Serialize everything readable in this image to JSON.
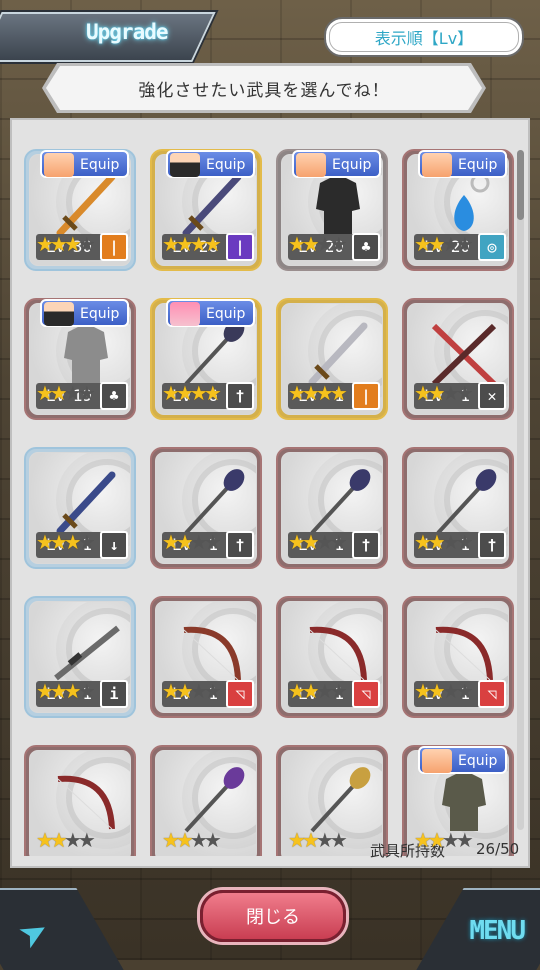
{
  "header": {
    "title": "Upgrade",
    "sort_label": "表示順【Lv】"
  },
  "banner": "強化させたい武具を選んでね！",
  "inventory": {
    "count_label": "武具所持数",
    "count_value": "26/50"
  },
  "bottom": {
    "close_label": "閉じる",
    "menu_label": "MENU"
  },
  "equip_label": "Equip",
  "lv_prefix": "Lv",
  "items": [
    {
      "name": "flame-sword",
      "rarity": "blue",
      "stars": 3,
      "level": "30",
      "type": "sword",
      "equip": "orange-hair",
      "color": "#d98a2b"
    },
    {
      "name": "dark-greatsword",
      "rarity": "gold",
      "stars": 4,
      "level": "26",
      "type": "greatsword",
      "equip": "black-hair",
      "color": "#4a4a7a"
    },
    {
      "name": "black-coat",
      "rarity": "gray",
      "stars": 2,
      "level": "20",
      "type": "armor",
      "equip": "orange-hair",
      "color": "#2b2b2b"
    },
    {
      "name": "blue-pendant",
      "rarity": "red",
      "stars": 2,
      "level": "20",
      "type": "accessory",
      "equip": "orange-hair",
      "color": "#2a8de0"
    },
    {
      "name": "plate-armor",
      "rarity": "red",
      "stars": 2,
      "level": "19",
      "type": "armor",
      "equip": "black-hair",
      "color": "#8c8c8c"
    },
    {
      "name": "spiked-mace",
      "rarity": "gold",
      "stars": 4,
      "level": "6",
      "type": "mace",
      "equip": "pink-hair",
      "color": "#3a3a5a"
    },
    {
      "name": "golden-sword",
      "rarity": "gold",
      "stars": 4,
      "level": "1",
      "type": "sword",
      "equip": "",
      "color": "#b8b8c0"
    },
    {
      "name": "crossed-blades",
      "rarity": "red",
      "stars": 2,
      "level": "1",
      "type": "dual",
      "equip": "",
      "color": "#5a2a2a"
    },
    {
      "name": "blue-spear",
      "rarity": "blue",
      "stars": 3,
      "level": "1",
      "type": "dagger",
      "equip": "",
      "color": "#3a4a8a"
    },
    {
      "name": "iron-mace-a",
      "rarity": "red",
      "stars": 2,
      "level": "1",
      "type": "mace",
      "equip": "",
      "color": "#3a3a6a"
    },
    {
      "name": "iron-mace-b",
      "rarity": "red",
      "stars": 2,
      "level": "1",
      "type": "mace",
      "equip": "",
      "color": "#3a3a6a"
    },
    {
      "name": "iron-mace-c",
      "rarity": "red",
      "stars": 2,
      "level": "1",
      "type": "mace",
      "equip": "",
      "color": "#3a3a6a"
    },
    {
      "name": "sniper-rifle",
      "rarity": "blue",
      "stars": 3,
      "level": "1",
      "type": "gun",
      "equip": "",
      "color": "#6a6a6a"
    },
    {
      "name": "ornate-bow",
      "rarity": "red",
      "stars": 2,
      "level": "1",
      "type": "bow",
      "equip": "",
      "color": "#8a3a2a"
    },
    {
      "name": "red-bow-a",
      "rarity": "red",
      "stars": 2,
      "level": "1",
      "type": "bow",
      "equip": "",
      "color": "#8a2a2a"
    },
    {
      "name": "red-bow-b",
      "rarity": "red",
      "stars": 2,
      "level": "1",
      "type": "bow",
      "equip": "",
      "color": "#8a2a2a"
    },
    {
      "name": "red-bow-c",
      "rarity": "red",
      "stars": 2,
      "level": "",
      "type": "bow",
      "equip": "",
      "color": "#8a2a2a"
    },
    {
      "name": "purple-staff",
      "rarity": "red",
      "stars": 2,
      "level": "",
      "type": "staff",
      "equip": "",
      "color": "#6a3a9a"
    },
    {
      "name": "jeweled-staff",
      "rarity": "red",
      "stars": 2,
      "level": "",
      "type": "staff",
      "equip": "",
      "color": "#c8a040"
    },
    {
      "name": "light-armor",
      "rarity": "red",
      "stars": 2,
      "level": "",
      "type": "armor",
      "equip": "orange-hair",
      "color": "#5a5a4a"
    }
  ],
  "type_icons": {
    "sword": "|",
    "greatsword": "|",
    "armor": "♣",
    "accessory": "◎",
    "mace": "†",
    "dual": "✕",
    "dagger": "↓",
    "gun": "i",
    "bow": "◹",
    "staff": "†"
  },
  "type_colors": {
    "sword": "#e27d1d",
    "greatsword": "#6a3ac0",
    "armor": "#4c4c4c",
    "accessory": "#41a4c2",
    "mace": "#4c4c4c",
    "dual": "#4c4c4c",
    "dagger": "#4c4c4c",
    "gun": "#4c4c4c",
    "bow": "#d94040",
    "staff": "#4c4c4c"
  }
}
